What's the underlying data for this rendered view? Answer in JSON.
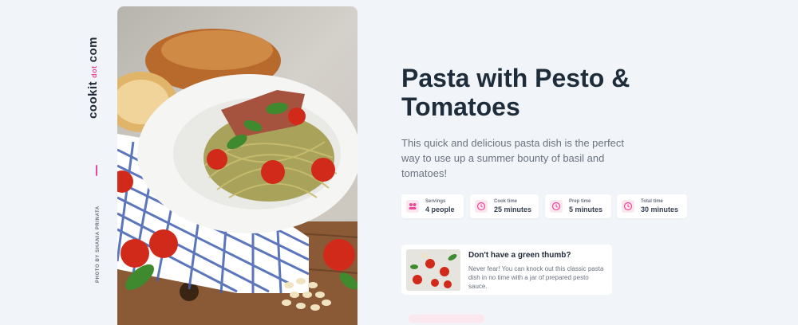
{
  "brand": {
    "part1": "cookit",
    "part2": "dot",
    "part3": "com",
    "accent": "#ec4899"
  },
  "credit": "PHOTO BY SHANIA PRINATA",
  "recipe": {
    "title": "Pasta with Pesto & Tomatoes",
    "description": "This quick and delicious pasta dish is the perfect way to use up a summer bounty of basil and tomatoes!"
  },
  "stats": [
    {
      "label": "Servings",
      "value": "4 people",
      "icon": "people-icon"
    },
    {
      "label": "Cook time",
      "value": "25 minutes",
      "icon": "clock-icon"
    },
    {
      "label": "Prep time",
      "value": "5 minutes",
      "icon": "clock-icon"
    },
    {
      "label": "Total time",
      "value": "30 minutes",
      "icon": "clock-icon"
    }
  ],
  "tip": {
    "heading": "Don't have a green thumb?",
    "body": "Never fear! You can knock out this classic pasta dish in no time with a jar of prepared pesto sauce."
  }
}
